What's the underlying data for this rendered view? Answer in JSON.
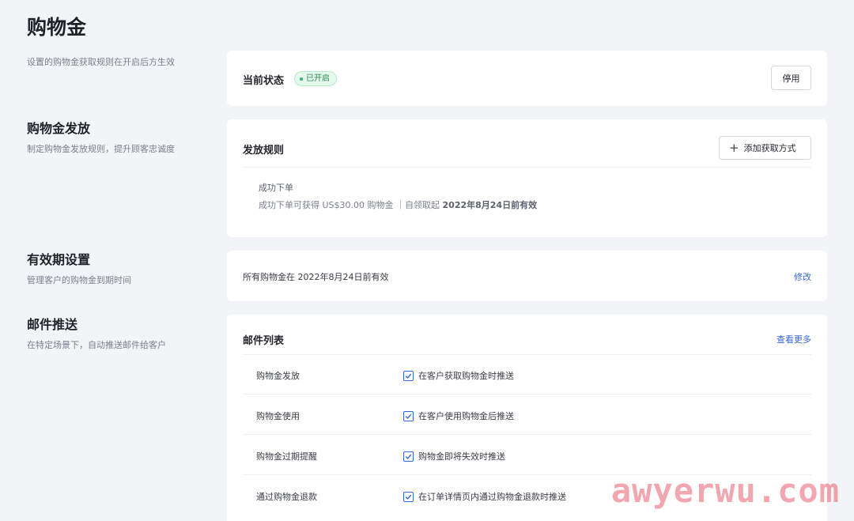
{
  "page": {
    "title": "购物金",
    "subtitle": "设置的购物金获取规则在开启后方生效"
  },
  "status_card": {
    "label": "当前状态",
    "badge": "已开启",
    "disable_button": "停用"
  },
  "issuance": {
    "title": "购物金发放",
    "desc": "制定购物金发放规则，提升顾客忠诚度",
    "card_title": "发放规则",
    "add_button": "添加获取方式",
    "rule_name": "成功下单",
    "rule_desc_prefix": "成功下单可获得 US$30.00 购物金 ｜自领取起",
    "rule_desc_strong": "2022年8月24日前有效"
  },
  "validity": {
    "title": "有效期设置",
    "desc": "管理客户的购物金到期时间",
    "text": "所有购物金在 2022年8月24日前有效",
    "edit_link": "修改"
  },
  "email": {
    "title": "邮件推送",
    "desc": "在特定场景下，自动推送邮件给客户",
    "card_title": "邮件列表",
    "more_link": "查看更多",
    "rows": [
      {
        "name": "购物金发放",
        "check_label": "在客户获取购物金时推送",
        "checked": true
      },
      {
        "name": "购物金使用",
        "check_label": "在客户使用购物金后推送",
        "checked": true
      },
      {
        "name": "购物金过期提醒",
        "check_label": "购物金即将失效时推送",
        "checked": true
      },
      {
        "name": "通过购物金退款",
        "check_label": "在订单详情页内通过购物金退款时推送",
        "checked": true
      }
    ]
  },
  "watermark": "awyerwu.com",
  "colors": {
    "accent": "#3567e0",
    "badge_bg": "#e4f8ec",
    "badge_text": "#2b8a52",
    "page_bg": "#f3f4f7"
  }
}
